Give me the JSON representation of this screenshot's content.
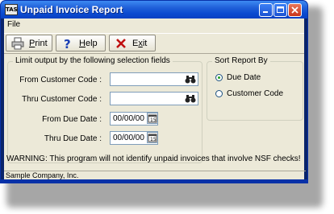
{
  "window": {
    "title": "Unpaid Invoice Report",
    "app_icon_text": "TAS"
  },
  "menu": {
    "file": "File"
  },
  "toolbar": {
    "print_label": "Print",
    "help_label": "Help",
    "exit_label": "Exit"
  },
  "limit_group": {
    "title": "Limit output by the following selection fields",
    "from_customer_label": "From Customer Code :",
    "from_customer_value": "",
    "thru_customer_label": "Thru Customer Code :",
    "thru_customer_value": "",
    "from_due_label": "From Due Date :",
    "from_due_value": "00/00/00",
    "thru_due_label": "Thru Due Date :",
    "thru_due_value": "00/00/00"
  },
  "sort_group": {
    "title": "Sort Report By",
    "options": [
      {
        "label": "Due Date",
        "selected": true
      },
      {
        "label": "Customer Code",
        "selected": false
      }
    ]
  },
  "warning": "WARNING: This program will not identify unpaid invoices that involve NSF checks!",
  "status": "Sample Company, Inc.",
  "colors": {
    "titlebar": "#0b4bd1",
    "client_bg": "#ece9d8",
    "close_button": "#c9331a"
  }
}
